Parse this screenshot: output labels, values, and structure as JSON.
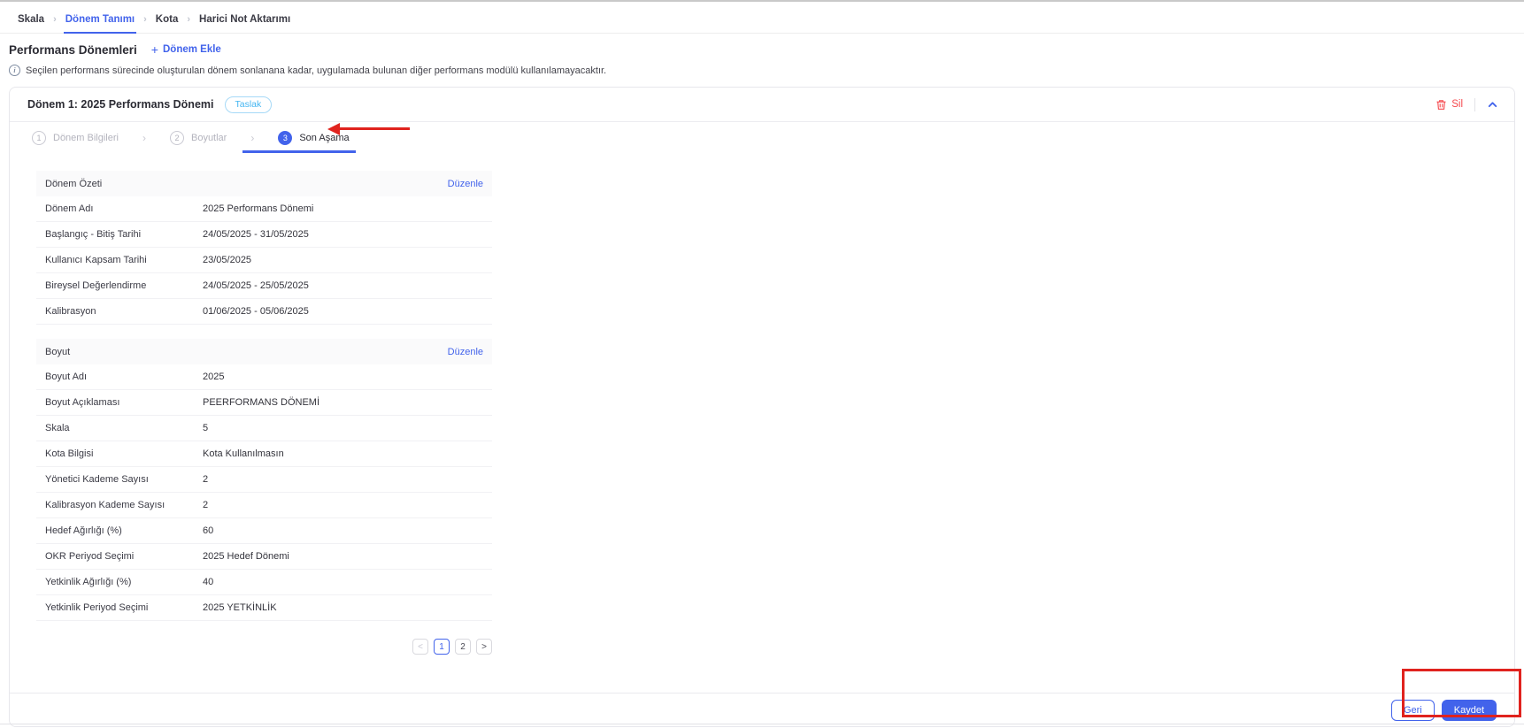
{
  "breadcrumb": {
    "separator": "›",
    "items": [
      {
        "label": "Skala"
      },
      {
        "label": "Dönem Tanımı"
      },
      {
        "label": "Kota"
      },
      {
        "label": "Harici Not Aktarımı"
      }
    ],
    "active_item": "Dönem Tanımı"
  },
  "page_header": {
    "title": "Performans Dönemleri",
    "add_icon": "+",
    "add_button_label": "Dönem Ekle",
    "info_icon": "i",
    "info_text": "Seçilen performans sürecinde oluşturulan dönem sonlanana kadar, uygulamada bulunan diğer performans modülü kullanılamayacaktır."
  },
  "period_card": {
    "title": "Dönem 1: 2025 Performans Dönemi",
    "status_badge": "Taslak",
    "delete_button_label": "Sil",
    "stepper": {
      "separator": "›",
      "active_step": "3",
      "steps": [
        {
          "number": "1",
          "label": "Dönem Bilgileri"
        },
        {
          "number": "2",
          "label": "Boyutlar"
        },
        {
          "number": "3",
          "label": "Son Aşama"
        }
      ]
    },
    "sections": [
      {
        "title": "Dönem Özeti",
        "edit_link_label": "Düzenle",
        "rows": [
          {
            "label": "Dönem Adı",
            "value": "2025 Performans Dönemi"
          },
          {
            "label": "Başlangıç - Bitiş Tarihi",
            "value": "24/05/2025 - 31/05/2025"
          },
          {
            "label": "Kullanıcı Kapsam Tarihi",
            "value": "23/05/2025"
          },
          {
            "label": "Bireysel Değerlendirme",
            "value": "24/05/2025 - 25/05/2025"
          },
          {
            "label": "Kalibrasyon",
            "value": "01/06/2025 - 05/06/2025"
          }
        ]
      },
      {
        "title": "Boyut",
        "edit_link_label": "Düzenle",
        "rows": [
          {
            "label": "Boyut Adı",
            "value": "2025"
          },
          {
            "label": "Boyut Açıklaması",
            "value": "PEERFORMANS DÖNEMİ"
          },
          {
            "label": "Skala",
            "value": "5"
          },
          {
            "label": "Kota Bilgisi",
            "value": "Kota Kullanılmasın"
          },
          {
            "label": "Yönetici Kademe Sayısı",
            "value": "2"
          },
          {
            "label": "Kalibrasyon Kademe Sayısı",
            "value": "2"
          },
          {
            "label": "Hedef Ağırlığı (%)",
            "value": "60"
          },
          {
            "label": "OKR Periyod Seçimi",
            "value": "2025 Hedef Dönemi"
          },
          {
            "label": "Yetkinlik Ağırlığı (%)",
            "value": "40"
          },
          {
            "label": "Yetkinlik Periyod Seçimi",
            "value": "2025 YETKİNLİK"
          }
        ]
      }
    ],
    "pagination": {
      "prev_label": "<",
      "pages": [
        "1",
        "2"
      ],
      "active_page": "1",
      "next_label": ">"
    },
    "footer": {
      "back_button_label": "Geri",
      "save_button_label": "Kaydet"
    }
  },
  "annotations": {
    "step_arrow_note": "red arrow pointing at Son Aşama step",
    "footer_box_note": "red box highlighting Geri and Kaydet buttons"
  },
  "colors": {
    "accent": "#4263eb",
    "danger": "#f5484d",
    "annotation_red": "#e0231e",
    "badge_blue": "#45b6f2"
  }
}
